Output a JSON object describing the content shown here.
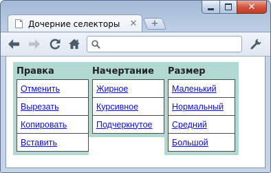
{
  "window": {
    "controls": {
      "minimize": "minimize",
      "maximize": "maximize",
      "close": "✕"
    }
  },
  "tab": {
    "title": "Дочерние селекторы",
    "close_glyph": "✕",
    "new_tab_glyph": "+"
  },
  "toolbar": {
    "back_icon": "arrow-left-icon",
    "forward_icon": "arrow-right-icon",
    "reload_icon": "reload-icon",
    "home_icon": "home-icon",
    "wrench_icon": "wrench-icon",
    "address_value": "",
    "address_placeholder": ""
  },
  "menu": {
    "colors": {
      "column_bg": "#b2d8d2",
      "link": "#0b0bd9",
      "border": "#4a4a4a"
    },
    "columns": [
      {
        "heading": "Правка",
        "items": [
          "Отменить",
          "Вырезать",
          "Копировать",
          "Вставить"
        ]
      },
      {
        "heading": "Начертание",
        "items": [
          "Жирное",
          "Курсивное",
          "Подчеркнутое"
        ]
      },
      {
        "heading": "Размер",
        "items": [
          "Маленький",
          "Нормальный",
          "Средний",
          "Большой"
        ]
      }
    ]
  }
}
